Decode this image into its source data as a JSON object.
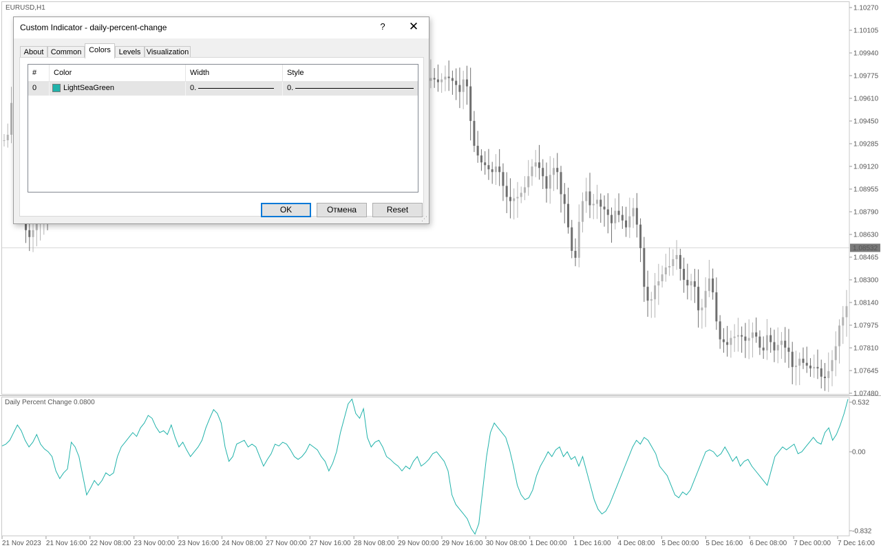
{
  "chart": {
    "symbol": "EURUSD,H1",
    "price_axis": [
      "1.10270",
      "1.10105",
      "1.09940",
      "1.09775",
      "1.09610",
      "1.09450",
      "1.09285",
      "1.09120",
      "1.08955",
      "1.08790",
      "1.08630",
      "1.08465",
      "1.08300",
      "1.08140",
      "1.07975",
      "1.07810",
      "1.07645",
      "1.07480"
    ],
    "current_price": "1.08532",
    "indicator_label": "Daily Percent Change 0.0800",
    "indicator_axis": [
      "0.532",
      "0.00",
      "-0.832"
    ],
    "time_axis": [
      "21 Nov 2023",
      "21 Nov 16:00",
      "22 Nov 08:00",
      "23 Nov 00:00",
      "23 Nov 16:00",
      "24 Nov 08:00",
      "27 Nov 00:00",
      "27 Nov 16:00",
      "28 Nov 08:00",
      "29 Nov 00:00",
      "29 Nov 16:00",
      "30 Nov 08:00",
      "1 Dec 00:00",
      "1 Dec 16:00",
      "4 Dec 08:00",
      "5 Dec 00:00",
      "5 Dec 16:00",
      "6 Dec 08:00",
      "7 Dec 00:00",
      "7 Dec 16:00"
    ],
    "colors": {
      "bull": "#b4b4b4",
      "bear": "#6e6e6e",
      "indicator": "#20b2aa",
      "grid": "#d0d0d0"
    },
    "price_series": [
      1.0931,
      1.0935,
      1.0958,
      1.0949,
      1.0917,
      1.0886,
      1.0866,
      1.0861,
      1.0866,
      1.0871,
      1.0876,
      1.0882,
      1.088,
      1.0876,
      1.0881,
      1.0887,
      1.089,
      1.0894,
      1.0897,
      1.0901,
      1.0903,
      1.0906,
      1.0907,
      1.0911,
      1.0913,
      1.0915,
      1.0917,
      1.0921,
      1.0925,
      1.0929,
      1.0933,
      1.0935,
      1.0938,
      1.0941,
      1.0944,
      1.0947,
      1.095,
      1.0953,
      1.0955,
      1.0958,
      1.096,
      1.0962,
      1.0964,
      1.0965,
      1.0966,
      1.0967,
      1.0967,
      1.0968,
      1.0969,
      1.097,
      1.097,
      1.0971,
      1.0971,
      1.0972,
      1.0973,
      1.0973,
      1.0974,
      1.0974,
      1.0974,
      1.0975,
      1.0975,
      1.0976,
      1.0976,
      1.0977,
      1.0977,
      1.0978,
      1.0978,
      1.0978,
      1.0979,
      1.0979,
      1.098,
      1.098,
      1.0981,
      1.0981,
      1.0982,
      1.0982,
      1.0983,
      1.0983,
      1.0983,
      1.0984,
      1.0984,
      1.0985,
      1.0985,
      1.0986,
      1.0986,
      1.0987,
      1.0987,
      1.0988,
      1.0988,
      1.0989,
      1.0989,
      1.099,
      1.099,
      1.099,
      1.0991,
      1.0991,
      1.0991,
      1.0992,
      1.0992,
      1.0992,
      1.0992,
      1.0993,
      1.0993,
      1.0993,
      1.0993,
      1.0992,
      1.099,
      1.0988,
      1.0985,
      1.0982,
      1.0979,
      1.0976,
      1.0973,
      1.0975,
      1.0977,
      1.0978,
      1.0976,
      1.0974,
      1.0976,
      1.0975,
      1.0973,
      1.0975,
      1.0977,
      1.0976,
      1.0974,
      1.0971,
      1.0966,
      1.0975,
      1.097,
      1.0945,
      1.0927,
      1.092,
      1.0915,
      1.0913,
      1.091,
      1.0908,
      1.0912,
      1.0908,
      1.0898,
      1.089,
      1.0887,
      1.0889,
      1.089,
      1.0893,
      1.0897,
      1.0905,
      1.0912,
      1.0915,
      1.0911,
      1.0905,
      1.0896,
      1.0906,
      1.0911,
      1.0908,
      1.0892,
      1.0885,
      1.0868,
      1.0851,
      1.0846,
      1.0872,
      1.0887,
      1.0894,
      1.0884,
      1.0885,
      1.0888,
      1.0883,
      1.0881,
      1.0877,
      1.0871,
      1.088,
      1.0877,
      1.0873,
      1.0868,
      1.0876,
      1.0882,
      1.087,
      1.0853,
      1.0825,
      1.0815,
      1.0816,
      1.0826,
      1.0829,
      1.0834,
      1.0839,
      1.084,
      1.0845,
      1.0848,
      1.0838,
      1.083,
      1.0826,
      1.0829,
      1.0825,
      1.0808,
      1.081,
      1.0822,
      1.0831,
      1.0821,
      1.08,
      1.0787,
      1.0785,
      1.0783,
      1.0788,
      1.0789,
      1.079,
      1.0789,
      1.0786,
      1.0788,
      1.0792,
      1.0789,
      1.0781,
      1.0779,
      1.079,
      1.0785,
      1.0779,
      1.0783,
      1.0786,
      1.0781,
      1.0778,
      1.0767,
      1.0768,
      1.0773,
      1.077,
      1.0768,
      1.0766,
      1.0767,
      1.0766,
      1.076,
      1.0759,
      1.0764,
      1.0772,
      1.0782,
      1.0797,
      1.0803,
      1.0811
    ]
  },
  "indicator": {
    "series": [
      0.06,
      0.08,
      0.12,
      0.2,
      0.28,
      0.22,
      0.12,
      0.05,
      0.1,
      0.18,
      0.08,
      0.03,
      0.0,
      -0.05,
      -0.2,
      -0.28,
      -0.22,
      -0.18,
      0.1,
      0.05,
      -0.05,
      -0.25,
      -0.45,
      -0.38,
      -0.3,
      -0.35,
      -0.3,
      -0.22,
      -0.25,
      -0.22,
      -0.05,
      0.05,
      0.1,
      0.15,
      0.2,
      0.16,
      0.25,
      0.3,
      0.38,
      0.35,
      0.26,
      0.2,
      0.22,
      0.18,
      0.28,
      0.15,
      0.05,
      0.1,
      0.02,
      -0.05,
      0.0,
      0.05,
      0.12,
      0.25,
      0.35,
      0.44,
      0.4,
      0.3,
      0.05,
      -0.1,
      -0.05,
      0.08,
      0.1,
      0.12,
      0.05,
      0.08,
      0.05,
      -0.05,
      -0.15,
      -0.08,
      -0.02,
      0.08,
      0.06,
      0.1,
      0.08,
      0.02,
      -0.05,
      -0.08,
      -0.05,
      0.0,
      0.08,
      0.05,
      0.02,
      -0.05,
      -0.1,
      -0.2,
      -0.12,
      0.0,
      0.2,
      0.35,
      0.5,
      0.55,
      0.4,
      0.35,
      0.45,
      0.15,
      0.05,
      0.1,
      0.12,
      0.05,
      -0.05,
      -0.08,
      -0.12,
      -0.15,
      -0.2,
      -0.15,
      -0.18,
      -0.1,
      -0.05,
      -0.15,
      -0.12,
      -0.08,
      -0.02,
      0.0,
      -0.05,
      -0.1,
      -0.2,
      -0.45,
      -0.55,
      -0.6,
      -0.65,
      -0.7,
      -0.8,
      -0.86,
      -0.75,
      -0.4,
      -0.05,
      0.2,
      0.3,
      0.25,
      0.2,
      0.15,
      0.02,
      -0.15,
      -0.35,
      -0.45,
      -0.5,
      -0.48,
      -0.4,
      -0.25,
      -0.15,
      -0.08,
      0.0,
      -0.05,
      0.02,
      0.05,
      -0.05,
      0.0,
      -0.08,
      -0.05,
      -0.15,
      -0.05,
      -0.2,
      -0.35,
      -0.5,
      -0.6,
      -0.65,
      -0.62,
      -0.55,
      -0.45,
      -0.35,
      -0.25,
      -0.15,
      -0.05,
      0.05,
      0.12,
      0.08,
      0.15,
      0.12,
      0.05,
      -0.02,
      -0.15,
      -0.2,
      -0.25,
      -0.35,
      -0.45,
      -0.48,
      -0.42,
      -0.45,
      -0.4,
      -0.3,
      -0.2,
      -0.1,
      0.0,
      0.02,
      0.0,
      -0.05,
      -0.02,
      0.05,
      -0.02,
      -0.1,
      -0.05,
      -0.15,
      -0.1,
      -0.08,
      -0.15,
      -0.2,
      -0.25,
      -0.3,
      -0.35,
      -0.2,
      -0.05,
      0.0,
      0.05,
      0.02,
      0.05,
      0.08,
      -0.02,
      0.0,
      0.05,
      0.1,
      0.15,
      0.1,
      0.08,
      0.2,
      0.25,
      0.12,
      0.18,
      0.28,
      0.4,
      0.55
    ]
  },
  "dialog": {
    "title": "Custom Indicator - daily-percent-change",
    "help": "?",
    "close": "✕",
    "tabs": [
      "About",
      "Common",
      "Colors",
      "Levels",
      "Visualization"
    ],
    "active_tab": "Colors",
    "table": {
      "headers": [
        "#",
        "Color",
        "Width",
        "Style"
      ],
      "row": {
        "index": "0",
        "color_name": "LightSeaGreen",
        "color_hex": "#20b2aa",
        "width": "0.",
        "style": "0."
      }
    },
    "buttons": {
      "ok": "OK",
      "cancel": "Отмена",
      "reset": "Reset"
    }
  }
}
